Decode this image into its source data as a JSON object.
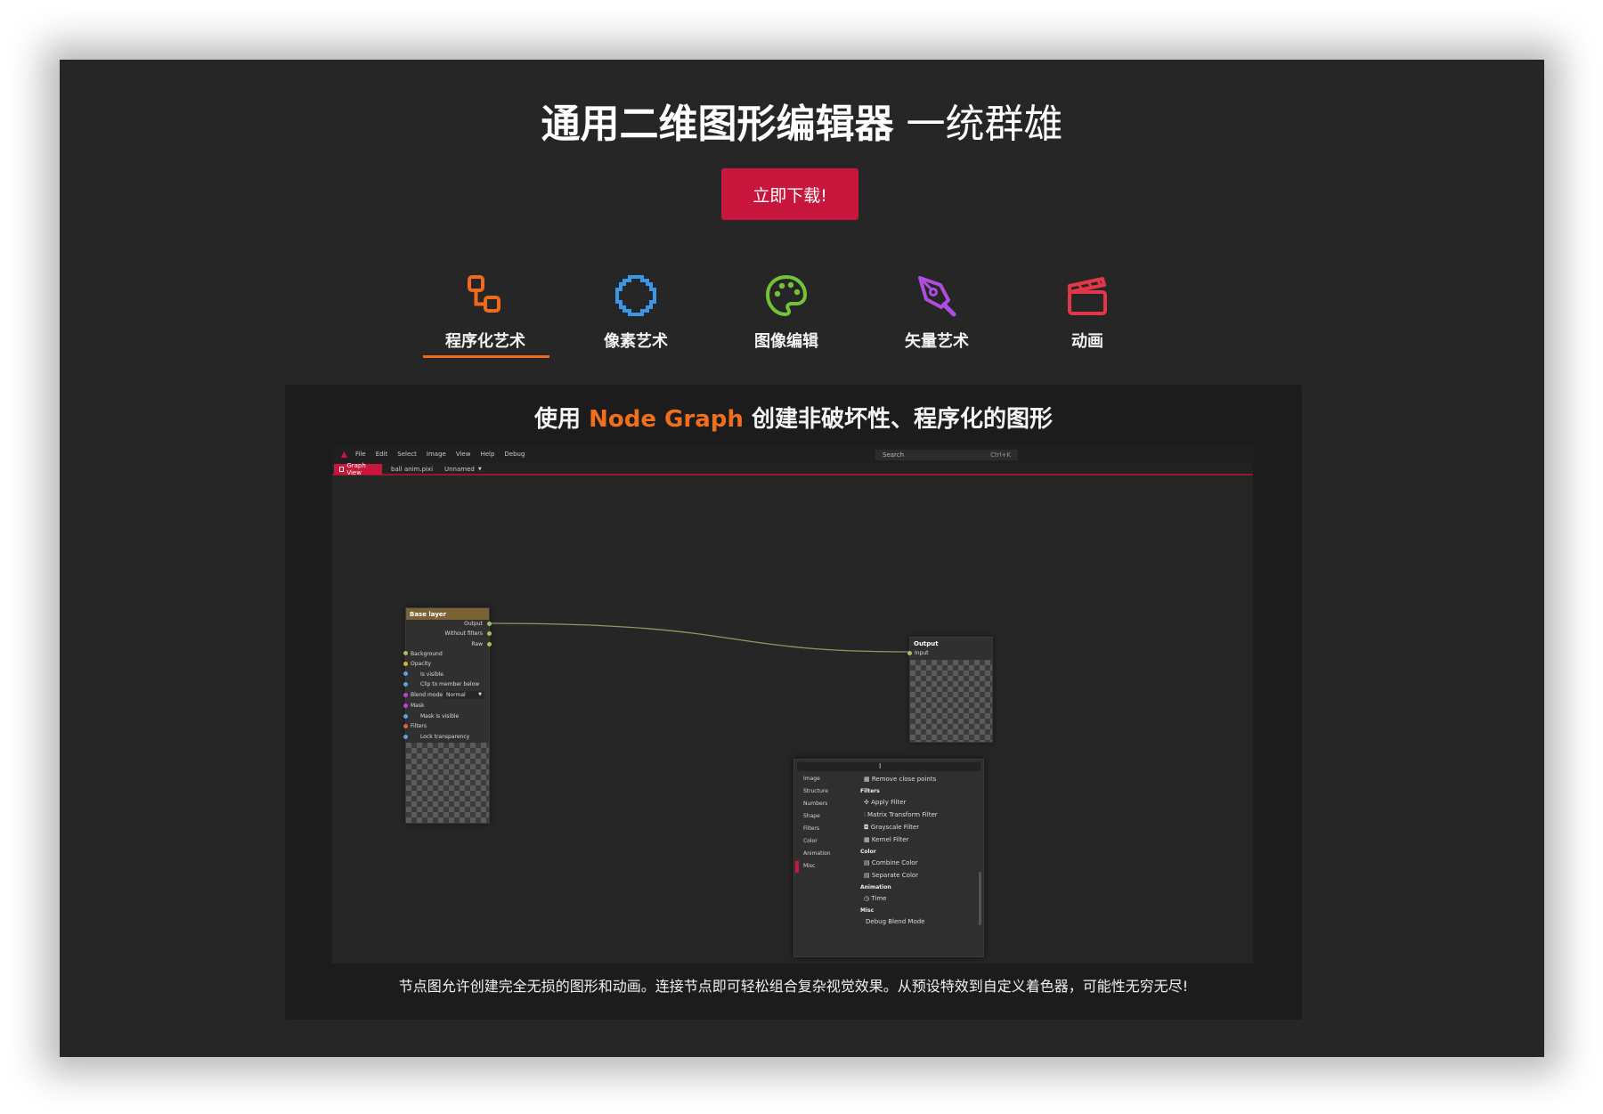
{
  "hero": {
    "title_strong": "通用二维图形编辑器",
    "title_light": "一统群雄",
    "download_label": "立即下载!"
  },
  "tabs": [
    {
      "label": "程序化艺术",
      "icon": "node-graph-icon",
      "color": "#ee6a1f",
      "active": true
    },
    {
      "label": "像素艺术",
      "icon": "pixel-circle-icon",
      "color": "#3a96e6",
      "active": false
    },
    {
      "label": "图像编辑",
      "icon": "palette-icon",
      "color": "#74c238",
      "active": false
    },
    {
      "label": "矢量艺术",
      "icon": "pen-nib-icon",
      "color": "#b04ce0",
      "active": false
    },
    {
      "label": "动画",
      "icon": "clapperboard-icon",
      "color": "#e2364a",
      "active": false
    }
  ],
  "feature": {
    "title_pre": "使用",
    "title_accent": "Node Graph",
    "title_post": "创建非破坏性、程序化的图形",
    "description": "节点图允许创建完全无损的图形和动画。连接节点即可轻松组合复杂视觉效果。从预设特效到自定义着色器，可能性无穷无尽!"
  },
  "app": {
    "menu": [
      "File",
      "Edit",
      "Select",
      "Image",
      "View",
      "Help",
      "Debug"
    ],
    "search_placeholder": "Search",
    "search_shortcut": "Ctrl+K",
    "doc_tabs": [
      "Graph View",
      "ball anim.pixi",
      "Unnamed"
    ],
    "base_node": {
      "title": "Base layer",
      "outputs": [
        "Output",
        "Without filters",
        "Raw"
      ],
      "inputs": [
        "Background",
        "Opacity",
        "Is visible",
        "Clip to member below",
        "Blend mode",
        "Mask",
        "Mask is visible",
        "Filters",
        "Lock transparency"
      ],
      "blend_value": "Normal"
    },
    "output_node": {
      "title": "Output",
      "input": "Input"
    },
    "context_menu": {
      "categories": [
        "Image",
        "Structure",
        "Numbers",
        "Shape",
        "Filters",
        "Color",
        "Animation",
        "Misc"
      ],
      "first_item": "Remove close points",
      "groups": [
        {
          "name": "Filters",
          "items": [
            "Apply Filter",
            "Matrix Transform Filter",
            "Grayscale Filter",
            "Kernel Filter"
          ]
        },
        {
          "name": "Color",
          "items": [
            "Combine Color",
            "Separate Color"
          ]
        },
        {
          "name": "Animation",
          "items": [
            "Time"
          ]
        },
        {
          "name": "Misc",
          "items": [
            "Debug Blend Mode"
          ]
        }
      ]
    }
  }
}
